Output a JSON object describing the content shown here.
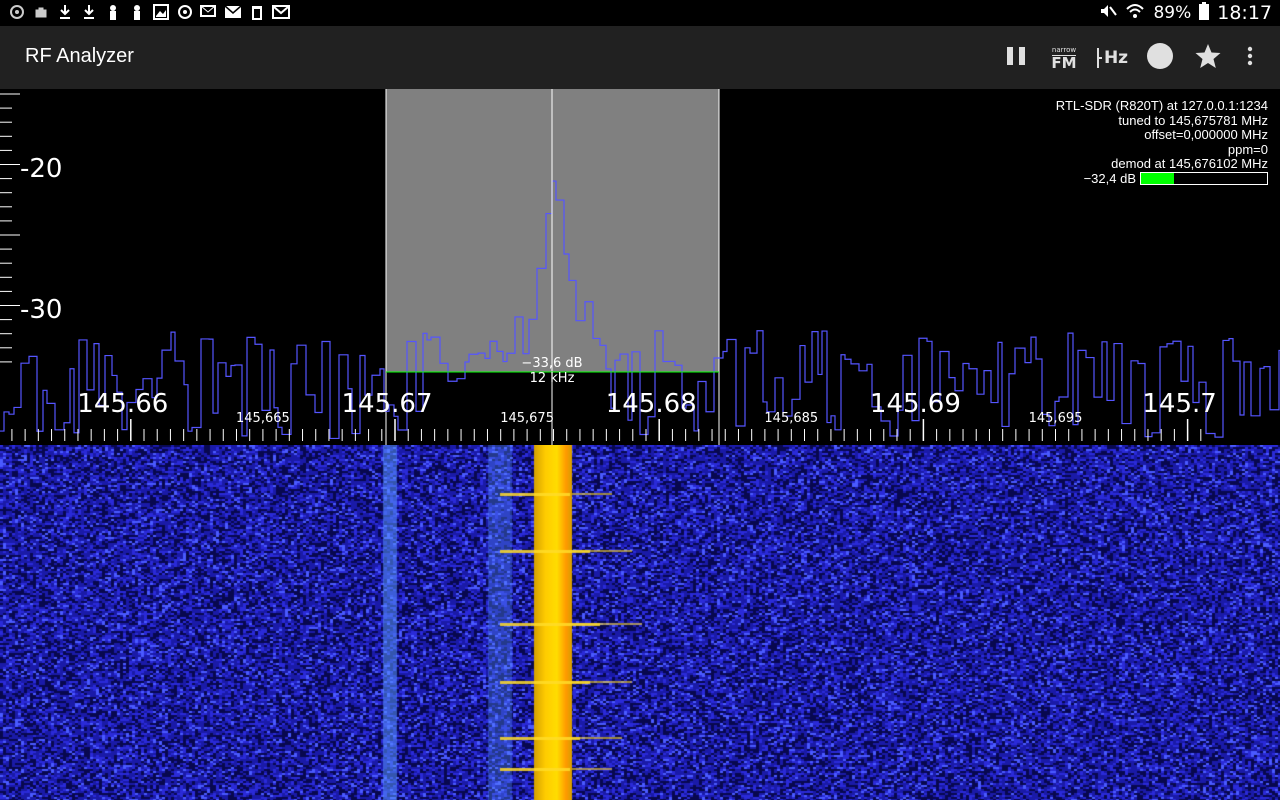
{
  "app": {
    "title": "RF Analyzer"
  },
  "status": {
    "battery": "89%",
    "time": "18:17"
  },
  "toolbar": {
    "pause": "pause-icon",
    "demod_icon_top": "narrow",
    "demod_icon_bottom": "FM",
    "frequency_icon": "Hz",
    "record": "record-icon",
    "bookmark": "star-icon",
    "overflow": "more-vert-icon"
  },
  "info": {
    "line1": "RTL-SDR (R820T) at 127.0.0.1:1234",
    "line2": "tuned to 145,675781 MHz",
    "line3": "offset=0,000000 MHz",
    "line4": "ppm=0",
    "line5": "demod at 145,676102 MHz",
    "level": "−32,4 dB",
    "level_fraction": 0.26,
    "level_color": "#00ff00"
  },
  "channel": {
    "squelch_label": "−33,6 dB",
    "bandwidth_label": "12 kHz",
    "selection_color": "#808080",
    "squelch_color": "#00ff00"
  },
  "y_axis": {
    "labels": [
      {
        "value": -20,
        "text": "-20"
      },
      {
        "value": -30,
        "text": "-30"
      }
    ]
  },
  "x_axis": {
    "major": [
      {
        "value": 145.66,
        "text": "145.66"
      },
      {
        "value": 145.67,
        "text": "145.67"
      },
      {
        "value": 145.68,
        "text": "145.68"
      },
      {
        "value": 145.69,
        "text": "145.69"
      },
      {
        "value": 145.7,
        "text": "145.7"
      }
    ],
    "minor": [
      {
        "value": 145.665,
        "text": "145,665"
      },
      {
        "value": 145.675,
        "text": "145,675"
      },
      {
        "value": 145.685,
        "text": "145,685"
      },
      {
        "value": 145.695,
        "text": "145,695"
      }
    ]
  },
  "colors": {
    "spectrum_line": "#5555ff",
    "waterfall_bg": "#1a1aa8",
    "signal_core": "#ffcc00",
    "appbar": "#212121"
  }
}
